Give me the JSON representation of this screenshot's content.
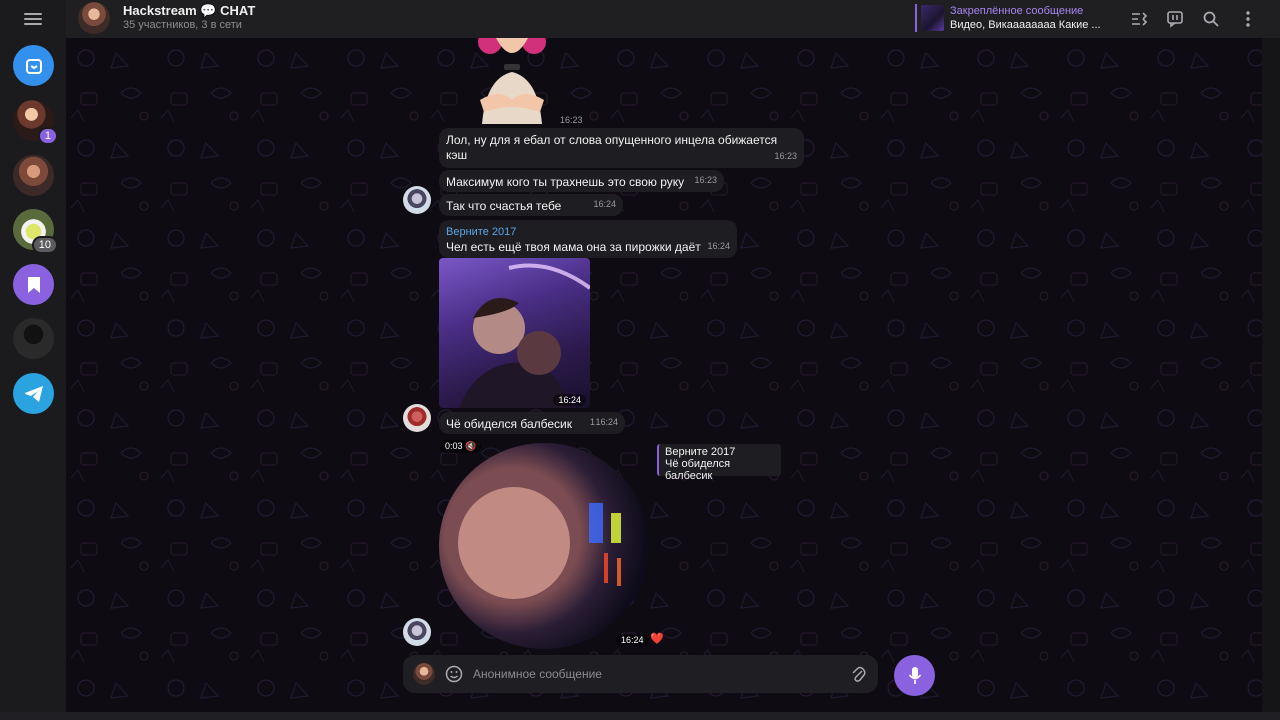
{
  "header": {
    "title": "Hackstream 💬 CHAT",
    "subtitle": "35 участников, 3 в сети",
    "pinned_label": "Закреплённое сообщение",
    "pinned_text": "Видео, Викаааааааа Какие ..."
  },
  "sidebar": {
    "badges": [
      "1",
      "10"
    ]
  },
  "messages": [
    {
      "text": "Лол, ну для я ебал от слова опущенного инцела обижается кэш",
      "time": "16:23"
    },
    {
      "text": "Максимум кого ты трахнешь это свою руку",
      "time": "16:23"
    },
    {
      "text": "Так что счастья тебе",
      "time": "16:24"
    },
    {
      "sender": "Верните 2017",
      "text": "Чел есть ещё твоя мама она за пирожки даёт",
      "time": "16:24"
    },
    {
      "text": "Чё обиделся балбесик",
      "views": "1",
      "time": "16:24"
    }
  ],
  "sticker_time": "16:23",
  "media_time": "16:24",
  "video_message": {
    "duration": "0:03",
    "time": "16:24",
    "reaction": "❤️",
    "reply_sender": "Верните 2017",
    "reply_text": "Чё обиделся балбесик"
  },
  "composer": {
    "placeholder": "Анонимное сообщение"
  },
  "colors": {
    "accent": "#8a62e0",
    "link": "#5aa7e8"
  }
}
